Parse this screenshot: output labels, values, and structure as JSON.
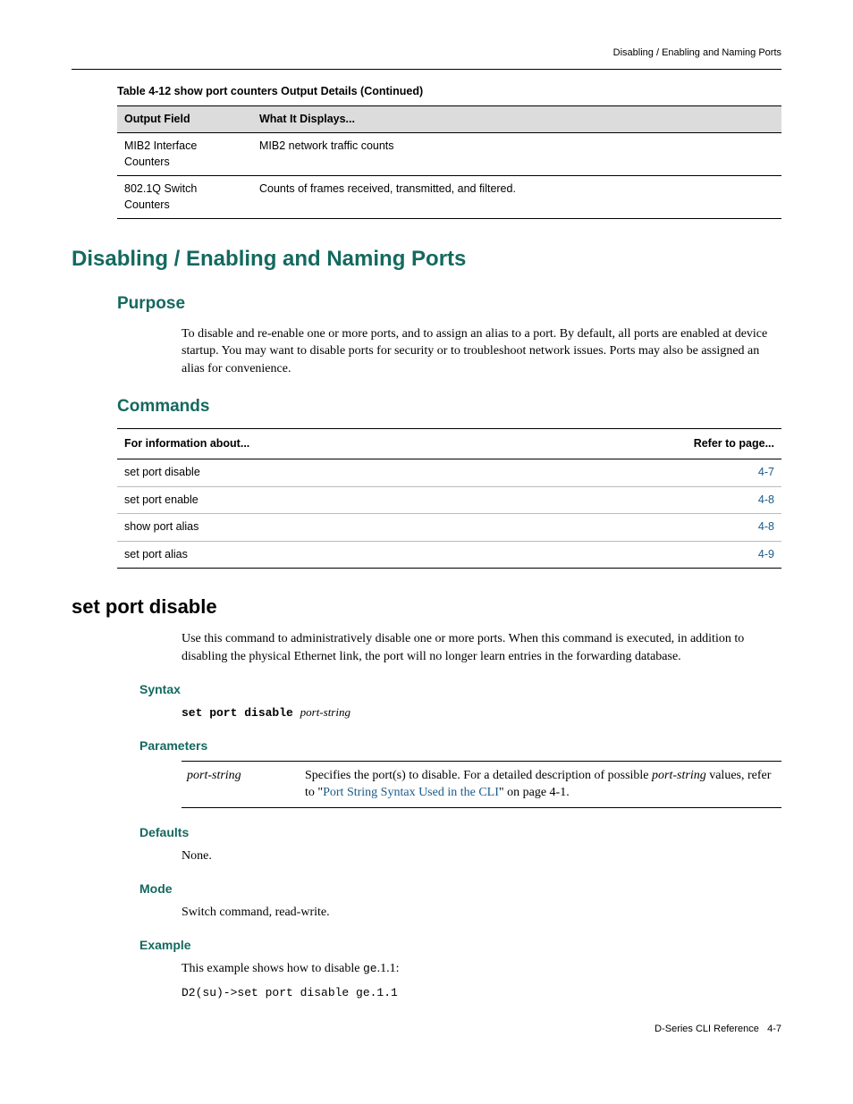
{
  "header": {
    "running": "Disabling / Enabling and Naming Ports"
  },
  "table412": {
    "caption": "Table 4-12   show port counters Output Details (Continued)",
    "col1": "Output Field",
    "col2": "What It Displays...",
    "rows": [
      {
        "c1": "MIB2 Interface Counters",
        "c2": "MIB2 network traffic counts"
      },
      {
        "c1": "802.1Q Switch Counters",
        "c2": "Counts of frames received, transmitted, and filtered."
      }
    ]
  },
  "section": {
    "title": "Disabling / Enabling and Naming Ports",
    "purpose": {
      "heading": "Purpose",
      "text": "To disable and re‑enable one or more ports, and to assign an alias to a port. By default, all ports are enabled at device startup. You may want to disable ports for security or to troubleshoot network issues. Ports may also be assigned an alias for convenience."
    },
    "commands": {
      "heading": "Commands",
      "col1": "For information about...",
      "col2": "Refer to page...",
      "rows": [
        {
          "c1": "set port disable",
          "c2": "4-7"
        },
        {
          "c1": "set port enable",
          "c2": "4-8"
        },
        {
          "c1": "show port alias",
          "c2": "4-8"
        },
        {
          "c1": "set port alias",
          "c2": "4-9"
        }
      ]
    }
  },
  "cmd": {
    "title": "set port disable",
    "intro": "Use this command to administratively disable one or more ports. When this command is executed, in addition to disabling the physical Ethernet link, the port will no longer learn entries in the forwarding database.",
    "syntax": {
      "heading": "Syntax",
      "kw": "set port disable",
      "arg": "port-string"
    },
    "parameters": {
      "heading": "Parameters",
      "name": "port‑string",
      "desc_pre": "Specifies the port(s) to disable. For a detailed description of possible ",
      "desc_ital": "port‑string",
      "desc_mid": " values, refer to \"",
      "desc_link": "Port String Syntax Used in the CLI",
      "desc_post": "\" on page 4‑1."
    },
    "defaults": {
      "heading": "Defaults",
      "text": "None."
    },
    "mode": {
      "heading": "Mode",
      "text": "Switch command, read‑write."
    },
    "example": {
      "heading": "Example",
      "lead_pre": "This example shows how to disable ",
      "lead_mono": "ge",
      "lead_post": ".1.1:",
      "code": "D2(su)->set port disable ge.1.1"
    }
  },
  "footer": {
    "left": "D-Series CLI Reference",
    "right": "4-7"
  }
}
